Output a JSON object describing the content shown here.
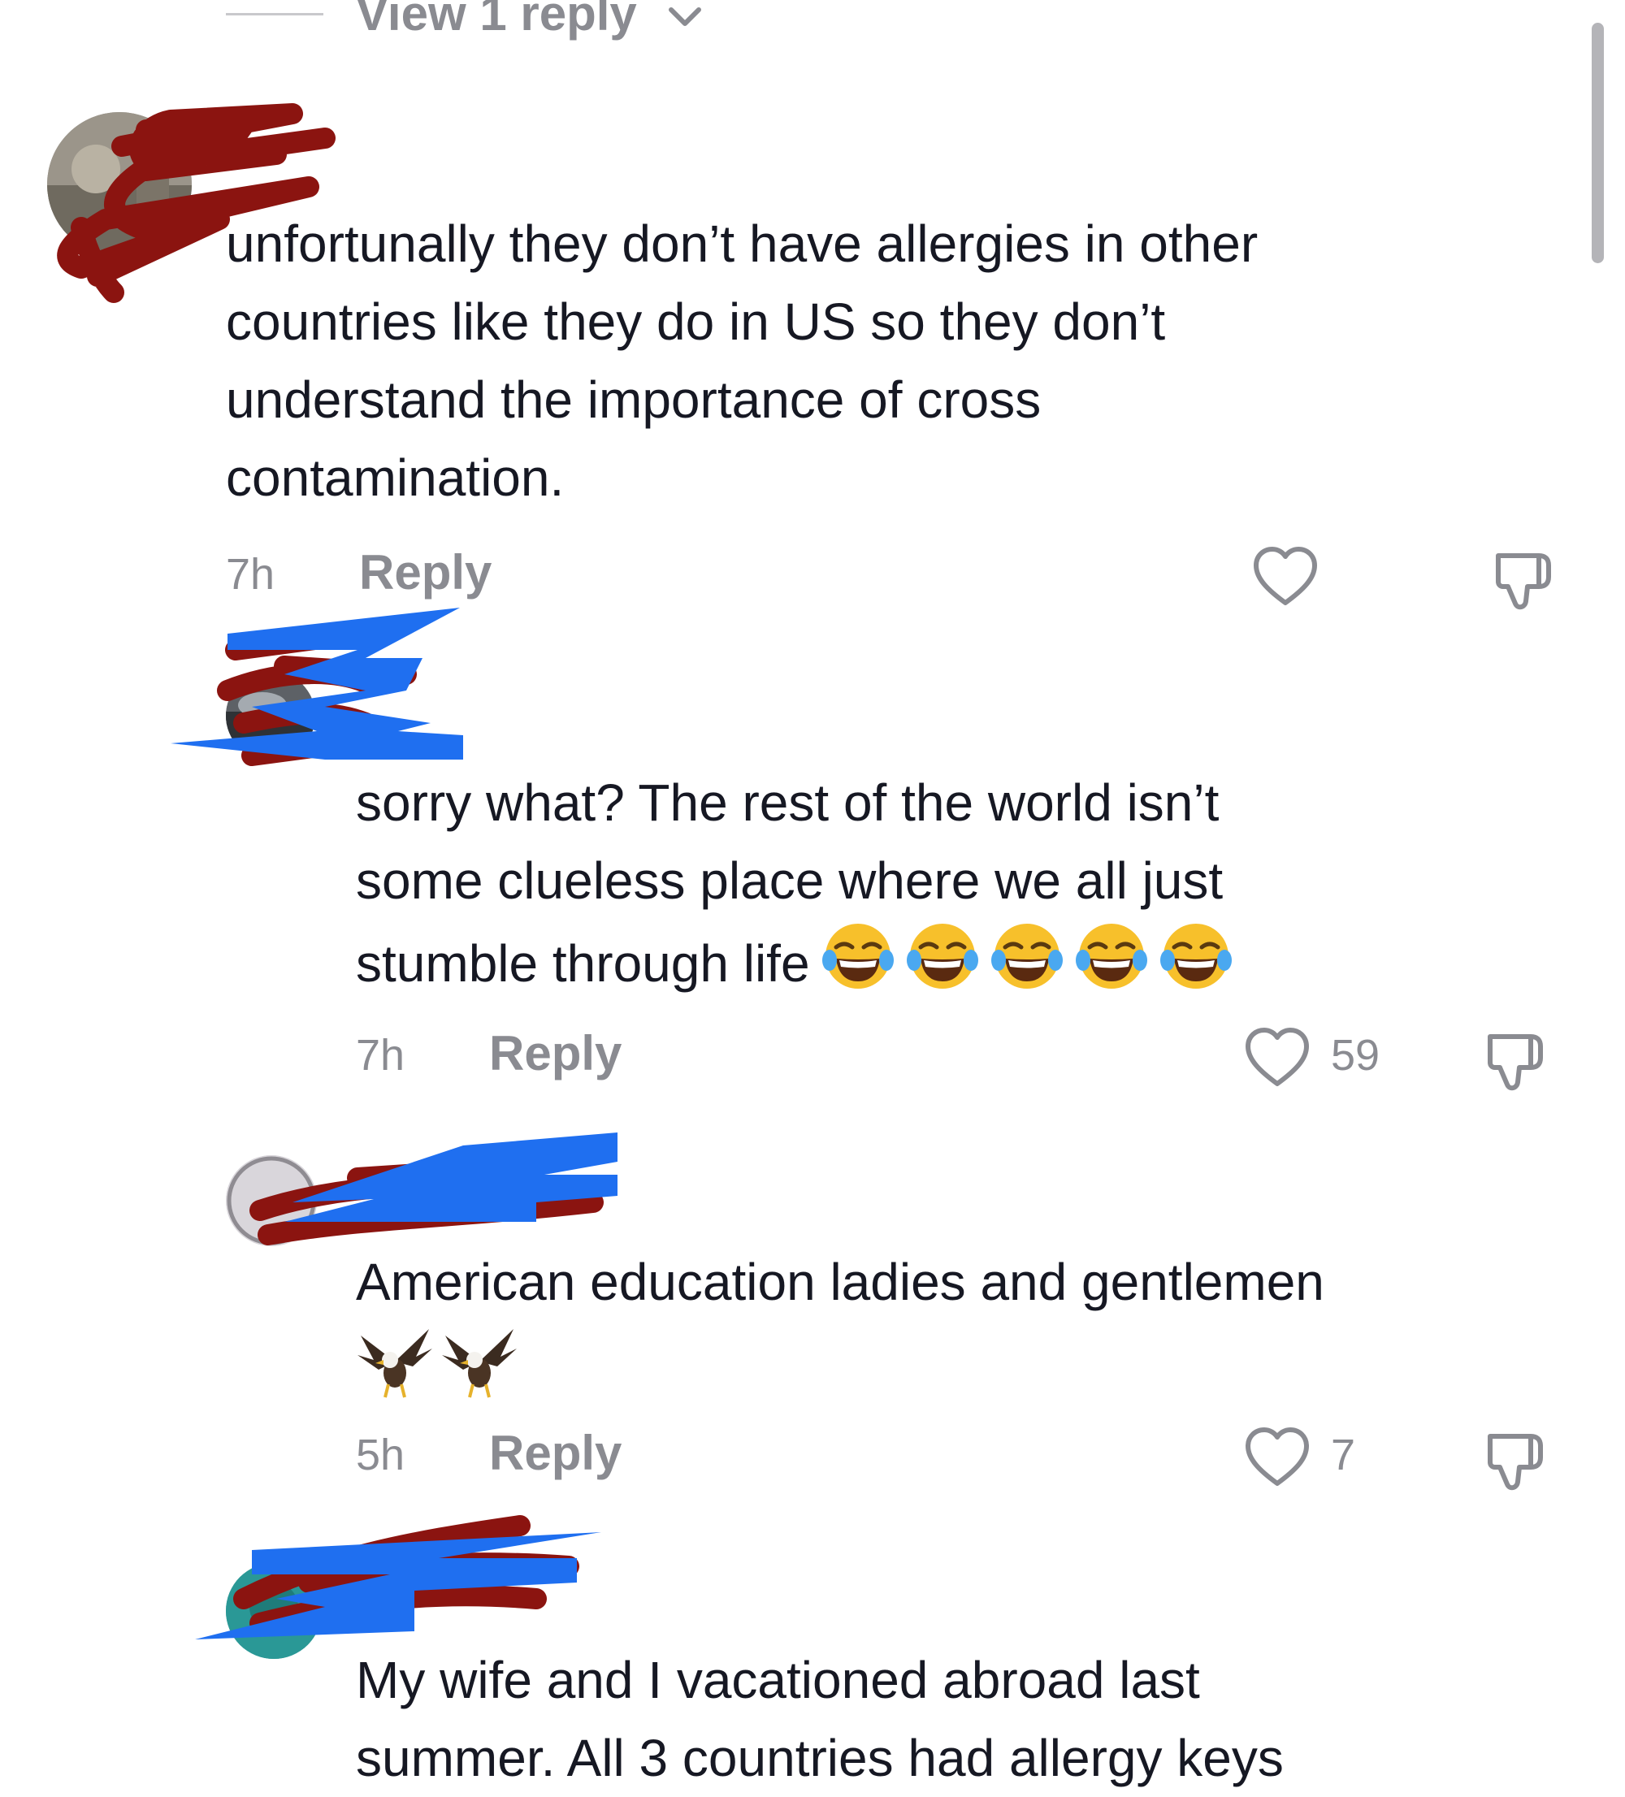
{
  "thread": {
    "view_replies_label": "View 1 reply"
  },
  "comments": [
    {
      "text": "unfortunally they don’t have allergies in other countries like they do in US so they don’t understand the importance of cross contamination.",
      "lines": [
        "unfortunally they don’t have allergies in other",
        "countries like they do in US so they don’t",
        "understand the importance of cross",
        "contamination."
      ],
      "time": "7h",
      "reply_label": "Reply",
      "like_count": ""
    },
    {
      "text": "sorry what? The rest of the world isn’t some clueless place where we all just stumble through life 😂😂😂😂😂",
      "lines": [
        "sorry what? The rest of the world isn’t",
        "some clueless place where we all just",
        "stumble through life"
      ],
      "emoji": [
        "face-with-tears-of-joy",
        "face-with-tears-of-joy",
        "face-with-tears-of-joy",
        "face-with-tears-of-joy",
        "face-with-tears-of-joy"
      ],
      "time": "7h",
      "reply_label": "Reply",
      "like_count": "59"
    },
    {
      "text": "American education ladies and gentlemen 🦅🦅",
      "lines": [
        "American education ladies and gentlemen"
      ],
      "emoji": [
        "eagle",
        "eagle"
      ],
      "time": "5h",
      "reply_label": "Reply",
      "like_count": "7"
    },
    {
      "text": "My wife and I vacationed abroad last summer. All 3 countries had allergy keys",
      "lines": [
        "My wife and I vacationed abroad last",
        "summer. All 3 countries had allergy keys"
      ],
      "time": "",
      "reply_label": "",
      "like_count": ""
    }
  ],
  "icons": {
    "like": "heart-outline-icon",
    "dislike": "thumbs-down-icon",
    "expand": "chevron-down-icon"
  },
  "colors": {
    "text": "#161823",
    "muted": "#8a8b91",
    "redaction_red": "#8b1410",
    "redaction_blue": "#1f6ff0",
    "emoji_yellow": "#f7c02b"
  }
}
